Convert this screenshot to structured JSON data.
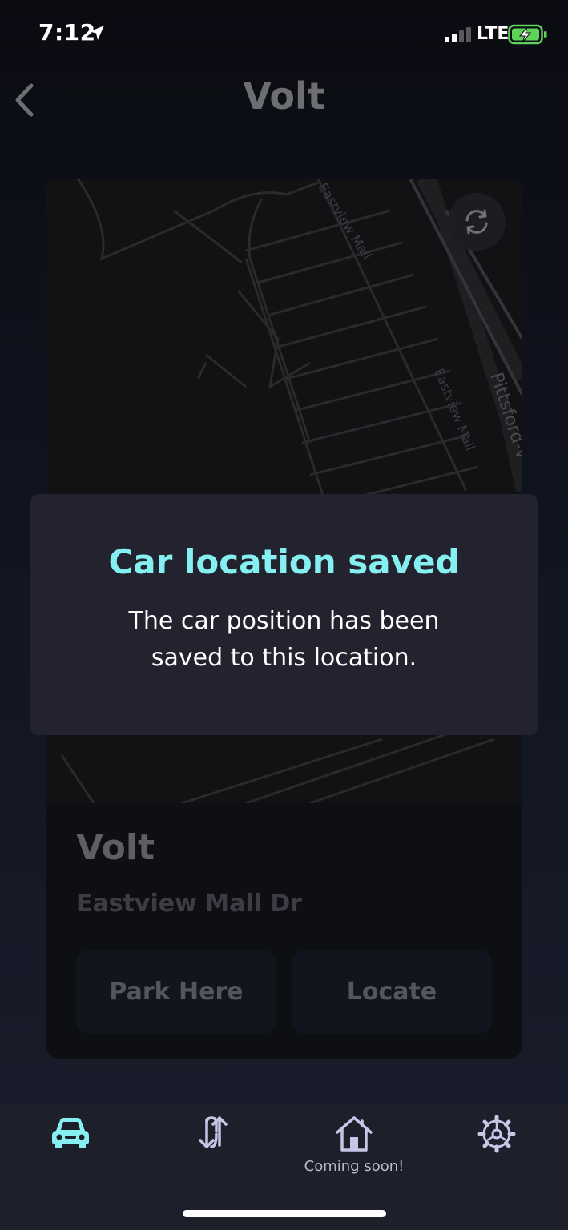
{
  "status_bar": {
    "time": "7:12",
    "network": "LTE"
  },
  "header": {
    "title": "Volt"
  },
  "map": {
    "labels": [
      "Eastview Mall",
      "Eastview Mall",
      "Pittsford-V"
    ]
  },
  "card": {
    "car_name": "Volt",
    "address": "Eastview Mall Dr",
    "park_label": "Park Here",
    "locate_label": "Locate"
  },
  "modal": {
    "title": "Car location saved",
    "message": "The car position has been saved to this location."
  },
  "tab_bar": {
    "home_label": "Coming soon!"
  },
  "colors": {
    "accent": "#86eff1",
    "modal_bg": "#22232f",
    "tab_bar_bg": "#1d1f2b",
    "battery_green": "#5fd35a",
    "tab_icon_lavender": "#c8c6e6"
  },
  "icons": {
    "back": "chevron-left-icon",
    "refresh": "refresh-icon",
    "tab_car": "car-icon",
    "tab_trips": "trips-arrows-icon",
    "tab_home": "home-icon",
    "tab_settings": "gear-icon"
  }
}
